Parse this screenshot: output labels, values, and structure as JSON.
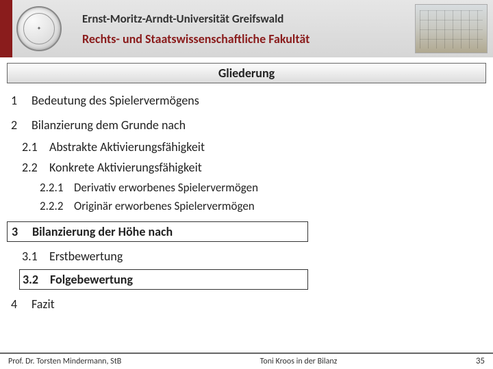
{
  "header": {
    "university": "Ernst-Moritz-Arndt-Universität Greifswald",
    "faculty": "Rechts- und Staatswissenschaftliche Fakultät"
  },
  "title": "Gliederung",
  "outline": {
    "i1_num": "1",
    "i1_text": "Bedeutung des Spielervermögens",
    "i2_num": "2",
    "i2_text": "Bilanzierung dem Grunde nach",
    "i21_num": "2.1",
    "i21_text": "Abstrakte Aktivierungsfähigkeit",
    "i22_num": "2.2",
    "i22_text": "Konkrete Aktivierungsfähigkeit",
    "i221_num": "2.2.1",
    "i221_text": "Derivativ erworbenes Spielervermögen",
    "i222_num": "2.2.2",
    "i222_text": "Originär erworbenes Spielervermögen",
    "i3_num": "3",
    "i3_text": "Bilanzierung der Höhe nach",
    "i31_num": "3.1",
    "i31_text": "Erstbewertung",
    "i32_num": "3.2",
    "i32_text": "Folgebewertung",
    "i4_num": "4",
    "i4_text": "Fazit"
  },
  "footer": {
    "author": "Prof. Dr. Torsten Mindermann, StB",
    "topic": "Toni Kroos in der Bilanz",
    "page": "35"
  }
}
